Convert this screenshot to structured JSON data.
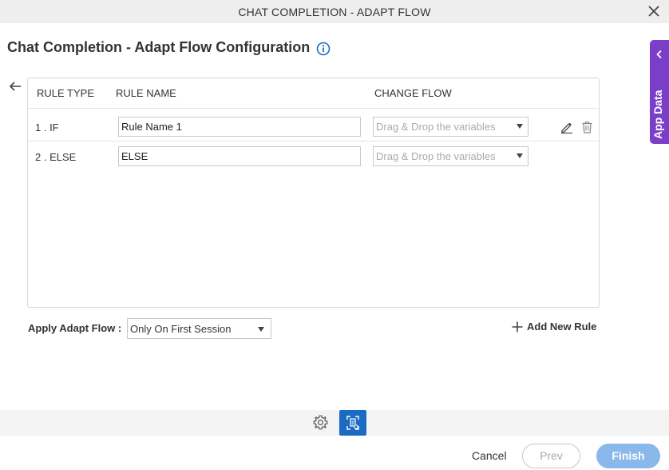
{
  "window": {
    "title": "CHAT COMPLETION - ADAPT FLOW"
  },
  "page": {
    "heading": "Chat Completion - Adapt Flow Configuration"
  },
  "table": {
    "headers": {
      "rule_type": "RULE TYPE",
      "rule_name": "RULE NAME",
      "change_flow": "CHANGE FLOW"
    },
    "rows": [
      {
        "rule_type": "1 . IF",
        "rule_name": "Rule Name 1",
        "change_flow_placeholder": "Drag & Drop the variables"
      },
      {
        "rule_type": "2 . ELSE",
        "rule_name": "ELSE",
        "change_flow_placeholder": "Drag & Drop the variables"
      }
    ]
  },
  "apply": {
    "label": "Apply Adapt Flow :",
    "selected": "Only On First Session"
  },
  "add_rule": {
    "label": "Add New Rule"
  },
  "side_panel": {
    "label": "App Data",
    "color": "#7a3ec9"
  },
  "footer": {
    "cancel": "Cancel",
    "prev": "Prev",
    "finish": "Finish",
    "finish_color": "#8ab8ea"
  },
  "toolbar": {
    "accent": "#1b6bc4"
  }
}
